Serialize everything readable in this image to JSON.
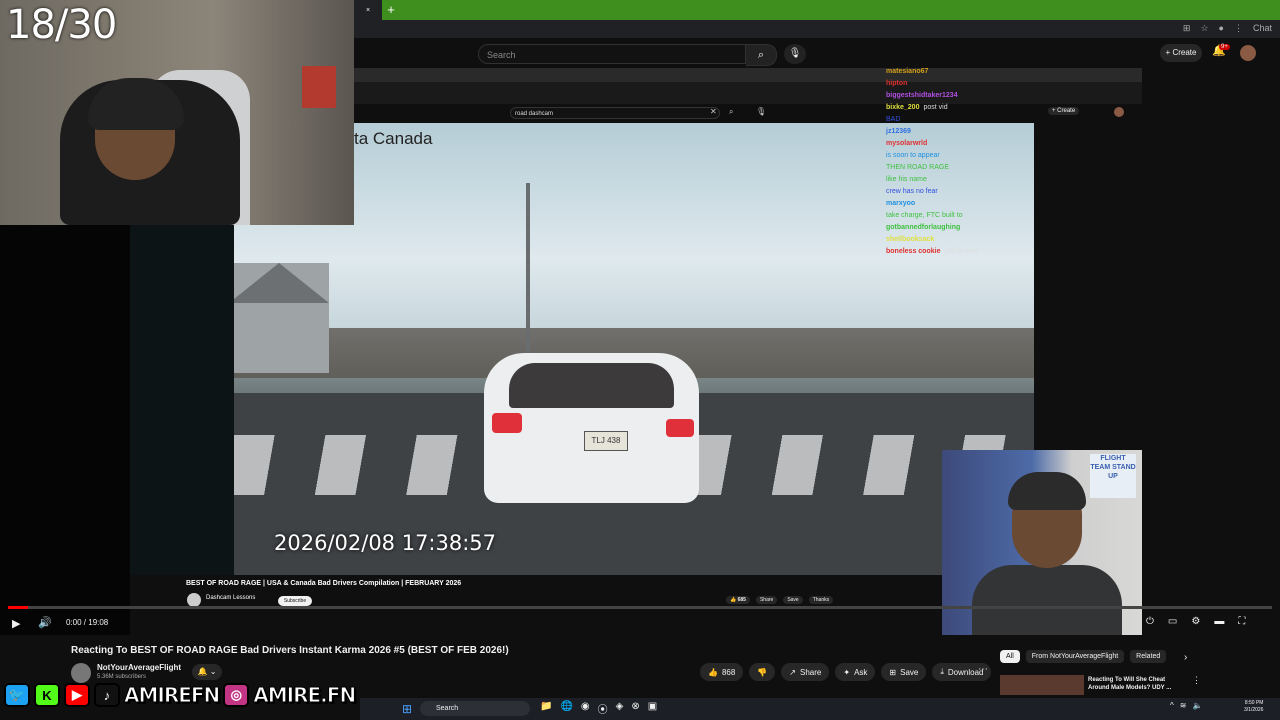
{
  "stream": {
    "counter": "18/30"
  },
  "browser": {
    "tab_close": "×",
    "new_tab": "+",
    "chat_button": "Chat"
  },
  "youtube": {
    "search_placeholder": "Search",
    "create_label": "Create",
    "notif_count": "9+"
  },
  "inner_page": {
    "search_value": "road dashcam",
    "create_label": "Create",
    "video_overlay_title": "ta Canada",
    "timestamp": "2026/02/08  17:38:57",
    "plate": "TLJ 438",
    "video_title": "BEST OF ROAD RAGE | USA & Canada Bad Drivers Compilation | FEBRUARY 2026",
    "channel": "Dashcam Lessons",
    "subscribe": "Subscribe",
    "likes": "685",
    "share": "Share",
    "save": "Save",
    "thanks": "Thanks"
  },
  "chat": [
    {
      "user": "matesiano67",
      "msg": "",
      "color": "#d4a017"
    },
    {
      "user": "hipton",
      "msg": "",
      "color": "#e03030"
    },
    {
      "user": "biggestshidtaker1234",
      "msg": "",
      "color": "#b050e0"
    },
    {
      "user": "bixke_200",
      "msg": "post vid",
      "color": "#e0e040"
    },
    {
      "user": "",
      "msg": "BAD",
      "color": "#3050e0"
    },
    {
      "user": "jz12369",
      "msg": "",
      "color": "#3070e0"
    },
    {
      "user": "mysolarwrld",
      "msg": "",
      "color": "#e03030"
    },
    {
      "user": "",
      "msg": "is soon to appear",
      "color": "#2090e0"
    },
    {
      "user": "",
      "msg": "THEN ROAD RAGE",
      "color": "#40c040"
    },
    {
      "user": "",
      "msg": "like his name",
      "color": "#40c040"
    },
    {
      "user": "",
      "msg": "crew has no fear",
      "color": "#3050e0"
    },
    {
      "user": "marxyoo",
      "msg": "",
      "color": "#2090e0"
    },
    {
      "user": "",
      "msg": "take charge, FTC built to",
      "color": "#40c040"
    },
    {
      "user": "gotbannedforlaughing",
      "msg": "",
      "color": "#40c040"
    },
    {
      "user": "shellbooksack",
      "msg": "",
      "color": "#e0e040"
    },
    {
      "user": "boneless cookie",
      "msg": "yah is near",
      "color": "#e03030"
    }
  ],
  "sign_text": "FLIGHT TEAM STAND UP",
  "player": {
    "time": "0:00 / 19:08"
  },
  "video": {
    "title": "Reacting To BEST OF ROAD RAGE Bad Drivers Instant Karma 2026 #5 (BEST OF FEB 2026!)",
    "channel": "NotYourAverageFlight",
    "subscribers": "5.36M subscribers",
    "likes": "868",
    "share": "Share",
    "ask": "Ask",
    "save": "Save",
    "download": "Download"
  },
  "chips": [
    "All",
    "From NotYourAverageFlight",
    "Related"
  ],
  "recommended": {
    "title": "Reacting To Will She Cheat Around Male Models? UDY ..."
  },
  "socials": {
    "handle1": "AMIREFN",
    "handle2": "AMIRE.FN"
  },
  "taskbar": {
    "search": "Search",
    "time": "8:50 PM",
    "date": "3/1/2026"
  },
  "colors": {
    "accent_red": "#ff0000",
    "tab_green": "#3f8f1f"
  }
}
